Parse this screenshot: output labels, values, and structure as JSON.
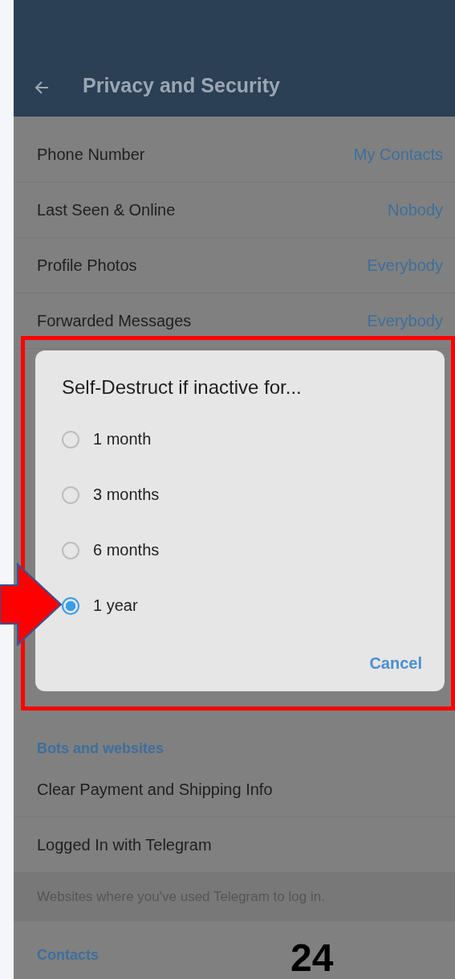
{
  "header": {
    "title": "Privacy and Security"
  },
  "privacy_rows": [
    {
      "label": "Phone Number",
      "value": "My Contacts"
    },
    {
      "label": "Last Seen & Online",
      "value": "Nobody"
    },
    {
      "label": "Profile Photos",
      "value": "Everybody"
    },
    {
      "label": "Forwarded Messages",
      "value": "Everybody"
    }
  ],
  "dialog": {
    "title": "Self-Destruct if inactive for...",
    "options": [
      {
        "label": "1 month",
        "selected": false
      },
      {
        "label": "3 months",
        "selected": false
      },
      {
        "label": "6 months",
        "selected": false
      },
      {
        "label": "1 year",
        "selected": true
      }
    ],
    "cancel": "Cancel"
  },
  "bots_section": {
    "title": "Bots and websites",
    "rows": [
      {
        "label": "Clear Payment and Shipping Info"
      },
      {
        "label": "Logged In with Telegram"
      }
    ],
    "footer": "Websites where you've used Telegram to log in."
  },
  "contacts_section": {
    "title": "Contacts"
  },
  "page_number": "24"
}
